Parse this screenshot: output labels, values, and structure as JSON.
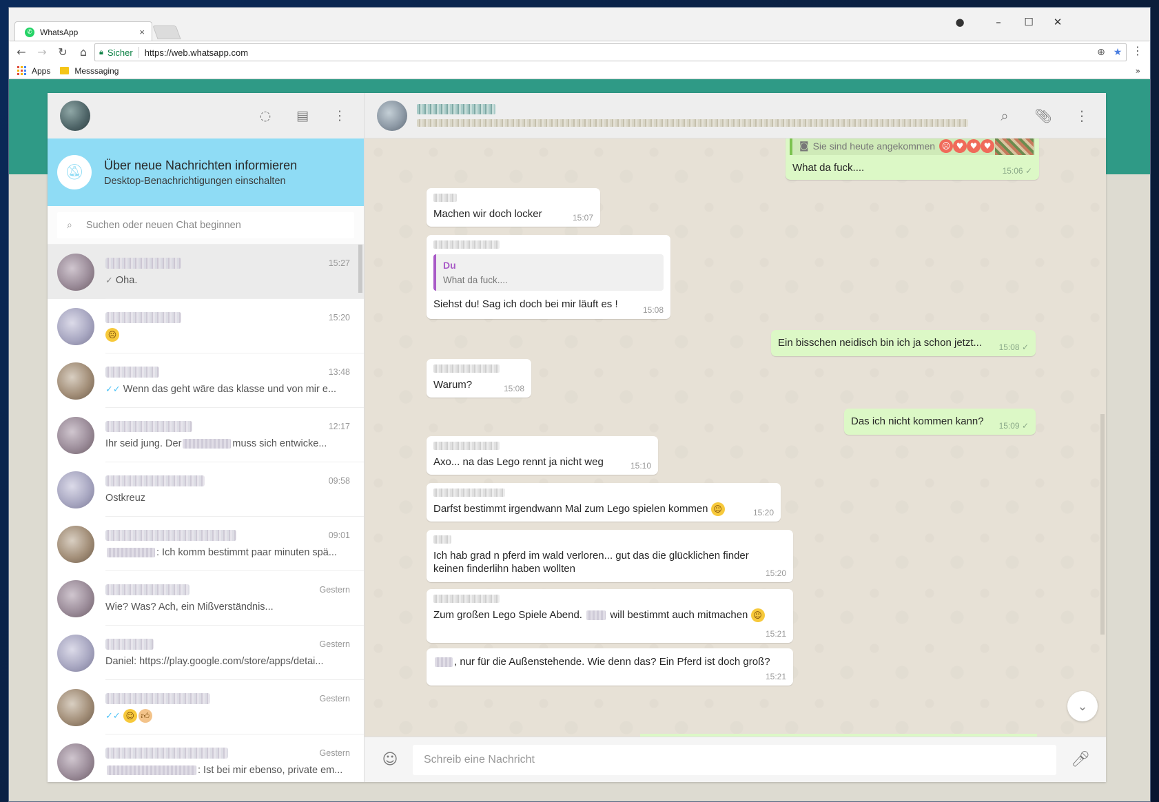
{
  "browser": {
    "tab_title": "WhatsApp",
    "tab_close": "×",
    "secure_label": "Sicher",
    "url": "https://web.whatsapp.com",
    "bookmarks": [
      {
        "label": "Apps"
      },
      {
        "label": "Messsaging"
      }
    ],
    "more": "»"
  },
  "sidebar": {
    "notification": {
      "title": "Über neue Nachrichten informieren",
      "subtitle": "Desktop-Benachrichtigungen einschalten"
    },
    "search": {
      "placeholder": "Suchen oder neuen Chat beginnen"
    },
    "chats": [
      {
        "time": "15:27",
        "preview": "Oha.",
        "tick": "✓"
      },
      {
        "time": "15:20",
        "preview": ""
      },
      {
        "time": "13:48",
        "preview": "Wenn das geht wäre das klasse und von mir e...",
        "tick": "✓✓"
      },
      {
        "time": "12:17",
        "preview_before": "Ihr seid jung. Der",
        "preview_after": "muss sich entwicke..."
      },
      {
        "time": "09:58",
        "preview": "Ostkreuz"
      },
      {
        "time": "09:01",
        "preview_after": ": Ich komm bestimmt paar minuten spä..."
      },
      {
        "time": "Gestern",
        "preview": "Wie? Was? Ach, ein Mißverständnis..."
      },
      {
        "time": "Gestern",
        "preview": "Daniel: https://play.google.com/store/apps/detai..."
      },
      {
        "time": "Gestern",
        "preview": "",
        "tick": "✓✓"
      },
      {
        "time": "Gestern",
        "preview_after": ": Ist bei mir ebenso, private em..."
      }
    ]
  },
  "conversation": {
    "top_message": {
      "caption": "Sie sind heute angekommen",
      "text": "What da fuck....",
      "time": "15:06 ✓"
    },
    "messages": [
      {
        "text": "Machen wir doch locker",
        "time": "15:07"
      },
      {
        "quote_author": "Du",
        "quote_text": "What da fuck....",
        "text": "Siehst du! Sag ich doch bei mir läuft es !",
        "time": "15:08"
      },
      {
        "text": "Ein bisschen neidisch bin ich ja schon jetzt...",
        "time": "15:08 ✓"
      },
      {
        "text": "Warum?",
        "time": "15:08"
      },
      {
        "text": "Das ich nicht kommen kann?",
        "time": "15:09 ✓"
      },
      {
        "text": "Axo... na das Lego rennt ja nicht weg",
        "time": "15:10"
      },
      {
        "text": "Darfst bestimmt irgendwann Mal zum Lego spielen kommen",
        "time": "15:20"
      },
      {
        "text": "Ich hab grad n pferd im wald verloren... gut das die glücklichen finder keinen finderlihn haben wollten",
        "time": "15:20"
      },
      {
        "text_before": "Zum großen Lego Spiele Abend.",
        "text_after": "will bestimmt auch mitmachen",
        "time": "15:21"
      },
      {
        "text": ", nur für die Außenstehende. Wie denn das? Ein Pferd ist doch groß?",
        "time": "15:21"
      }
    ],
    "composer": {
      "placeholder": "Schreib eine Nachricht"
    }
  }
}
